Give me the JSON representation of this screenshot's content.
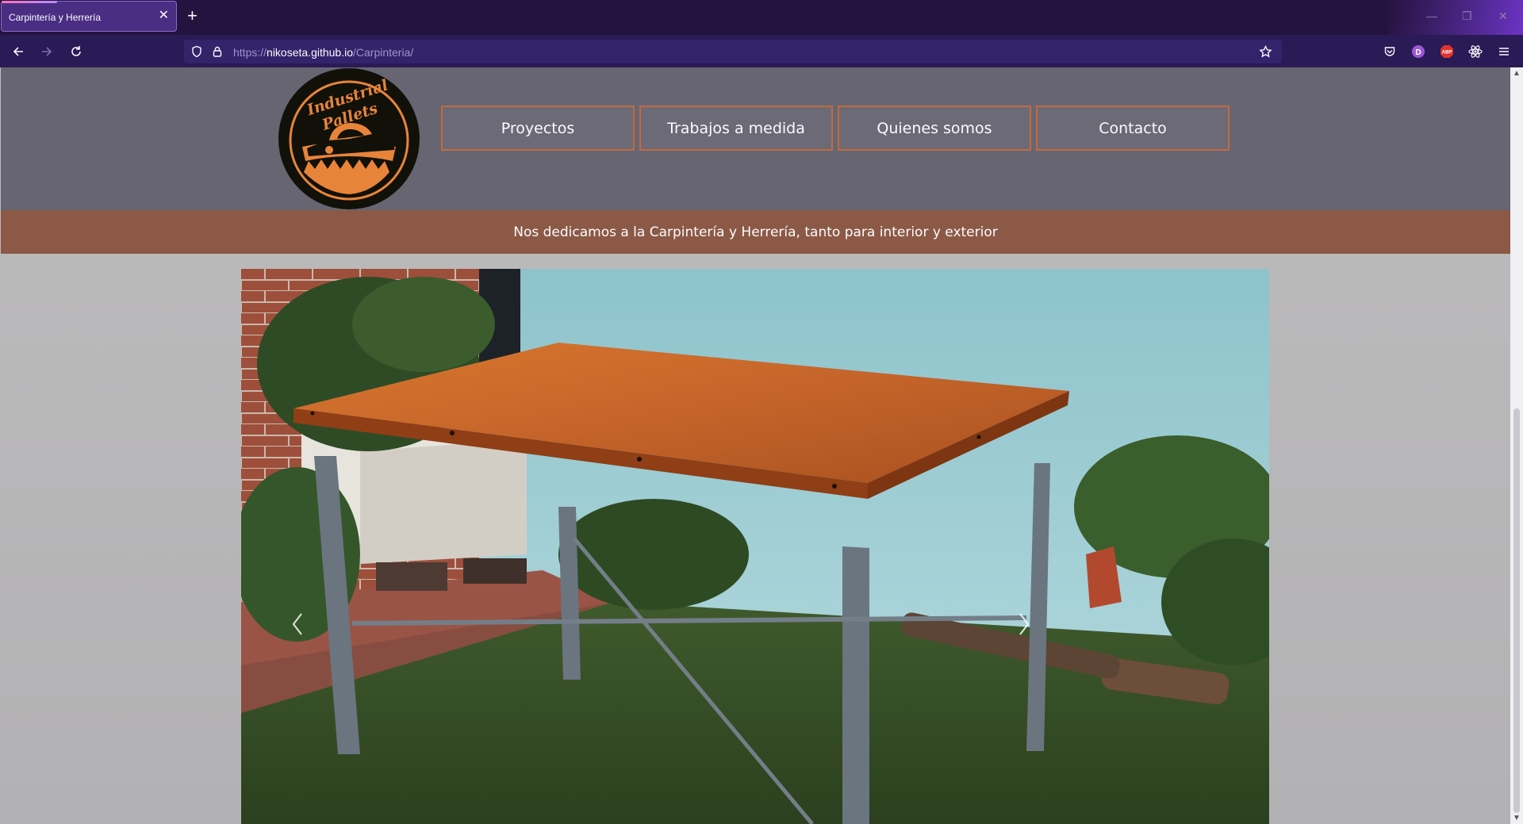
{
  "browser": {
    "tab_title": "Carpintería y Herrería",
    "url_prefix": "https://",
    "url_host": "nikoseta.github.io",
    "url_path": "/Carpinteria/"
  },
  "site": {
    "logo_text_line1": "Industrial",
    "logo_text_line2": "Pallets",
    "menu": [
      {
        "label": "Proyectos"
      },
      {
        "label": "Trabajos a medida"
      },
      {
        "label": "Quienes somos"
      },
      {
        "label": "Contacto"
      }
    ],
    "tagline": "Nos dedicamos a la Carpintería y Herrería, tanto para interior y exterior"
  },
  "colors": {
    "header_bg": "#676572",
    "menu_border": "#c26a3d",
    "tagline_bg": "#8b5946",
    "logo_orange": "#e8843a",
    "browser_bg": "#25133f"
  },
  "icons": {
    "back": "arrow-left-icon",
    "forward": "arrow-right-icon",
    "reload": "reload-icon",
    "shield": "shield-icon",
    "lock": "lock-icon",
    "bookmark": "star-icon",
    "pocket": "pocket-icon",
    "extensions": [
      "d-extension-icon",
      "adblock-icon",
      "react-devtools-icon"
    ],
    "menu": "hamburger-menu-icon"
  }
}
